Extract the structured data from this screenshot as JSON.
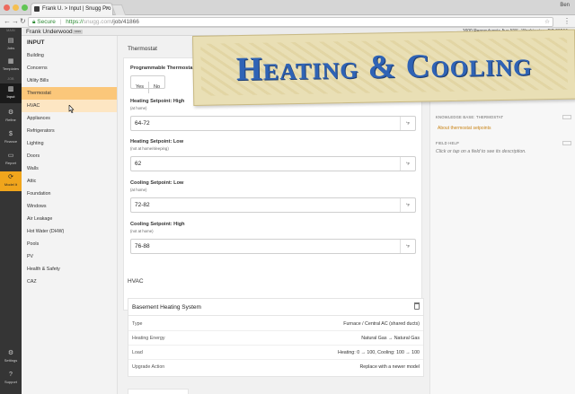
{
  "browser": {
    "tab_title": "Frank U. > Input | Snugg Pro",
    "window_user": "Ben",
    "secure_label": "Secure",
    "url_protocol": "https://",
    "url_path": "/job/41866"
  },
  "header": {
    "user_name": "Frank Underwood",
    "user_tag": "ssss",
    "address": "1600 Pennsylvania Ave NW , Washington, DC 20500"
  },
  "rail": {
    "section_main": "MAIN",
    "jobs": "Jobs",
    "templates": "Templates",
    "section_job": "JOB",
    "input": "Input",
    "refine": "Refine",
    "finance": "Finance",
    "report": "Report",
    "model": "Model It",
    "settings": "Settings",
    "support": "Support"
  },
  "sidebar": {
    "title": "INPUT",
    "items": [
      "Building",
      "Concerns",
      "Utility Bills",
      "Thermostat",
      "HVAC",
      "Appliances",
      "Refrigerators",
      "Lighting",
      "Doors",
      "Walls",
      "Attic",
      "Foundation",
      "Windows",
      "Air Leakage",
      "Hot Water (DHW)",
      "Pools",
      "PV",
      "Health & Safety",
      "CAZ"
    ],
    "selected": "Thermostat",
    "hovered": "HVAC"
  },
  "thermostat": {
    "section_title": "Thermostat",
    "programmable_label": "Programmable Thermostat Installed",
    "yes": "Yes",
    "no": "No",
    "fields": [
      {
        "label": "Heating Setpoint: High",
        "sub": "(at home)",
        "value": "64-72",
        "unit": "°F"
      },
      {
        "label": "Heating Setpoint: Low",
        "sub": "(not at home/sleeping)",
        "value": "62",
        "unit": "°F"
      },
      {
        "label": "Cooling Setpoint: Low",
        "sub": "(at home)",
        "value": "72-82",
        "unit": "°F"
      },
      {
        "label": "Cooling Setpoint: High",
        "sub": "(not at home)",
        "value": "76-88",
        "unit": "°F"
      }
    ]
  },
  "hvac": {
    "section_title": "HVAC",
    "system_name": "Basement Heating System",
    "rows": [
      {
        "key": "Type",
        "value": "Furnace / Central AC (shared ducts)"
      },
      {
        "key": "Heating Energy",
        "value": "Natural Gas → Natural Gas"
      },
      {
        "key": "Load",
        "value": "Heating: 0 → 100, Cooling: 100 → 100"
      },
      {
        "key": "Upgrade Action",
        "value": "Replace with a newer model"
      }
    ]
  },
  "right_panel": {
    "kb_title": "KNOWLEDGE BASE: THERMOSTAT",
    "kb_link": "About thermostat setpoints",
    "field_help_title": "FIELD HELP",
    "field_help_text": "Click or tap on a field to see its description."
  },
  "banner": {
    "title": "Heating & Cooling"
  }
}
